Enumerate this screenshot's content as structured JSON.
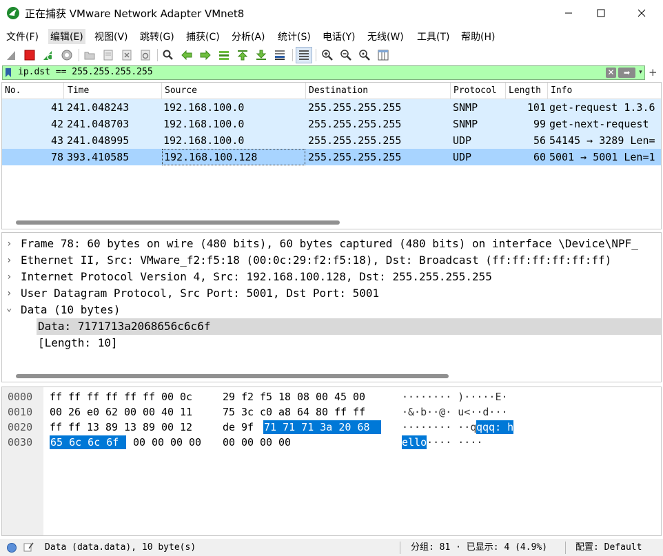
{
  "window": {
    "title": "正在捕获 VMware Network Adapter VMnet8",
    "minimize_glyph": "—",
    "maximize_glyph": "☐",
    "close_glyph": "✕"
  },
  "menu": [
    "文件(F)",
    "编辑(E)",
    "视图(V)",
    "跳转(G)",
    "捕获(C)",
    "分析(A)",
    "统计(S)",
    "电话(Y)",
    "无线(W)",
    "工具(T)",
    "帮助(H)"
  ],
  "active_menu": "编辑(E)",
  "toolbar_icons": [
    "shark-fin-start-icon",
    "stop-capture-icon",
    "restart-capture-icon",
    "capture-options-icon",
    "open-file-icon",
    "save-file-icon",
    "close-file-icon",
    "reload-file-icon",
    "find-packet-icon",
    "go-back-icon",
    "go-forward-icon",
    "go-to-packet-icon",
    "go-first-icon",
    "go-last-icon",
    "auto-scroll-icon",
    "colorize-icon",
    "zoom-in-icon",
    "zoom-out-icon",
    "zoom-normal-icon",
    "resize-columns-icon"
  ],
  "filter": {
    "value": "ip.dst == 255.255.255.255",
    "clear_glyph": "✕",
    "apply_glyph": "➡",
    "dropdown_glyph": "▾",
    "add_glyph": "+"
  },
  "packet_list": {
    "columns": [
      "No.",
      "Time",
      "Source",
      "Destination",
      "Protocol",
      "Length",
      "Info"
    ],
    "rows": [
      {
        "no": "41",
        "time": "241.048243",
        "source": "192.168.100.0",
        "destination": "255.255.255.255",
        "protocol": "SNMP",
        "length": "101",
        "info": "get-request 1.3.6"
      },
      {
        "no": "42",
        "time": "241.048703",
        "source": "192.168.100.0",
        "destination": "255.255.255.255",
        "protocol": "SNMP",
        "length": "99",
        "info": "get-next-request"
      },
      {
        "no": "43",
        "time": "241.048995",
        "source": "192.168.100.0",
        "destination": "255.255.255.255",
        "protocol": "UDP",
        "length": "56",
        "info": "54145 → 3289 Len="
      },
      {
        "no": "78",
        "time": "393.410585",
        "source": "192.168.100.128",
        "destination": "255.255.255.255",
        "protocol": "UDP",
        "length": "60",
        "info": "5001 → 5001 Len=1"
      }
    ],
    "selected_no": "78"
  },
  "details": {
    "collapsed_arrow": "›",
    "expanded_arrow": "⌄",
    "rows": [
      {
        "text": "Frame 78: 60 bytes on wire (480 bits), 60 bytes captured (480 bits) on interface \\Device\\NPF_",
        "state": "collapsed"
      },
      {
        "text": "Ethernet II, Src: VMware_f2:f5:18 (00:0c:29:f2:f5:18), Dst: Broadcast (ff:ff:ff:ff:ff:ff)",
        "state": "collapsed"
      },
      {
        "text": "Internet Protocol Version 4, Src: 192.168.100.128, Dst: 255.255.255.255",
        "state": "collapsed"
      },
      {
        "text": "User Datagram Protocol, Src Port: 5001, Dst Port: 5001",
        "state": "collapsed"
      },
      {
        "text": "Data (10 bytes)",
        "state": "expanded"
      },
      {
        "text": "Data: 7171713a2068656c6c6f",
        "state": "child-selected"
      },
      {
        "text": "[Length: 10]",
        "state": "child"
      }
    ]
  },
  "hex_dump": {
    "rows": [
      {
        "offset": "0000",
        "bytes": [
          "ff",
          "ff",
          "ff",
          "ff",
          "ff",
          "ff",
          "00",
          "0c",
          "29",
          "f2",
          "f5",
          "18",
          "08",
          "00",
          "45",
          "00"
        ],
        "ascii": "········ )·····E·"
      },
      {
        "offset": "0010",
        "bytes": [
          "00",
          "26",
          "e0",
          "62",
          "00",
          "00",
          "40",
          "11",
          "75",
          "3c",
          "c0",
          "a8",
          "64",
          "80",
          "ff",
          "ff"
        ],
        "ascii": "·&·b··@· u<··d···"
      },
      {
        "offset": "0020",
        "bytes": [
          "ff",
          "ff",
          "13",
          "89",
          "13",
          "89",
          "00",
          "12",
          "de",
          "9f",
          "71",
          "71",
          "71",
          "3a",
          "20",
          "68"
        ],
        "ascii": "········ ··qqq: h"
      },
      {
        "offset": "0030",
        "bytes": [
          "65",
          "6c",
          "6c",
          "6f",
          "00",
          "00",
          "00",
          "00",
          "00",
          "00",
          "00",
          "00"
        ],
        "ascii": "ello···· ····"
      }
    ],
    "highlight_hex_row2": "71 71 71 3a 20 68",
    "highlight_hex_row3": "65 6c 6c 6f",
    "highlight_ascii_row2": "qqq: h",
    "highlight_ascii_row3": "ello"
  },
  "status": {
    "field": "Data (data.data), 10 byte(s)",
    "packets": "分组: 81 · 已显示: 4 (4.9%)",
    "profile": "配置: Default"
  },
  "colors": {
    "row_bg": "#daeeff",
    "selected_row_bg": "#a8d4ff",
    "filter_bg": "#afffaf",
    "hex_highlight": "#0078d7",
    "detail_highlight": "#d9d9d9"
  }
}
